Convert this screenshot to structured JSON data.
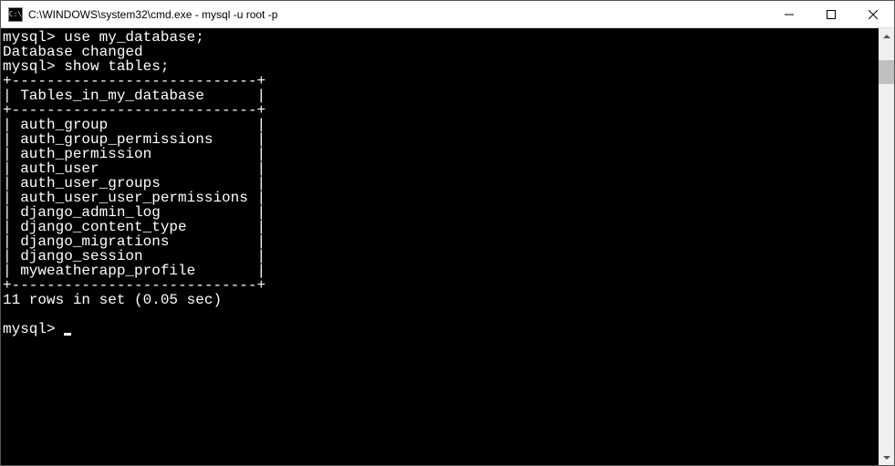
{
  "titlebar": {
    "icon_label": "cmd-icon",
    "title": "C:\\WINDOWS\\system32\\cmd.exe - mysql  -u root -p"
  },
  "terminal": {
    "prompt": "mysql>",
    "cmd1": "use my_database;",
    "response1": "Database changed",
    "cmd2": "show tables;",
    "table_border": "+----------------------------+",
    "table_header": "| Tables_in_my_database      |",
    "rows": [
      "| auth_group                 |",
      "| auth_group_permissions     |",
      "| auth_permission            |",
      "| auth_user                  |",
      "| auth_user_groups           |",
      "| auth_user_user_permissions |",
      "| django_admin_log           |",
      "| django_content_type        |",
      "| django_migrations          |",
      "| django_session             |",
      "| myweatherapp_profile       |"
    ],
    "summary": "11 rows in set (0.05 sec)"
  }
}
